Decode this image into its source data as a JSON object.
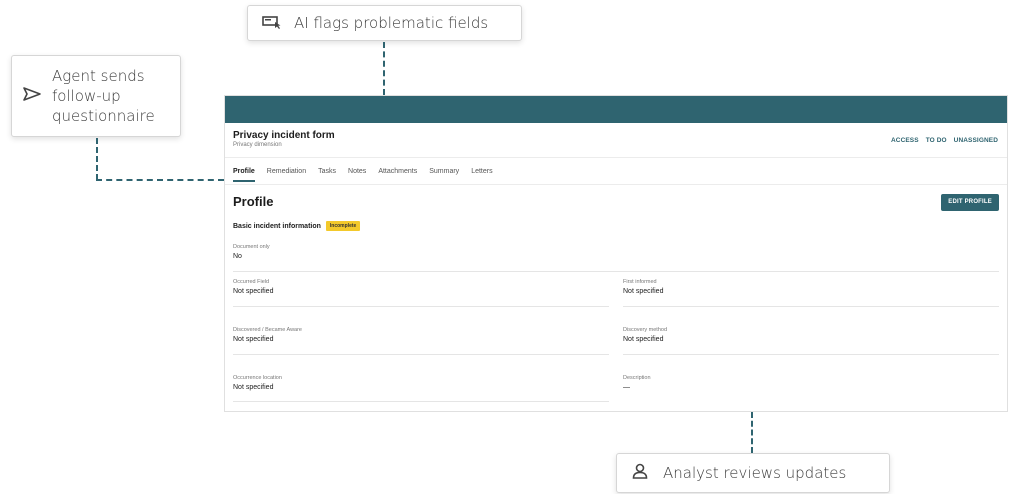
{
  "callouts": {
    "flags": {
      "text": "AI flags problematic fields",
      "icon": "ai-flag-icon"
    },
    "agent": {
      "line1": "Agent sends",
      "line2": "follow-up",
      "line3": "questionnaire",
      "icon": "send-icon"
    },
    "analyst": {
      "text": "Analyst reviews updates",
      "icon": "person-icon"
    }
  },
  "form": {
    "title": "Privacy incident form",
    "subtitle": "Privacy dimension",
    "header_links": [
      "ACCESS",
      "TO DO",
      "UNASSIGNED"
    ],
    "tabs": [
      "Profile",
      "Remediation",
      "Tasks",
      "Notes",
      "Attachments",
      "Summary",
      "Letters"
    ],
    "active_tab": "Profile",
    "page_title": "Profile",
    "edit_button": "EDIT PROFILE",
    "section_label": "Basic incident information",
    "section_badge": "Incomplete",
    "fields": {
      "document_only": {
        "label": "Document only",
        "value": "No"
      },
      "occurred_field": {
        "label": "Occurred Field",
        "value": "Not specified"
      },
      "first_informed": {
        "label": "First informed",
        "value": "Not specified"
      },
      "discovered": {
        "label": "Discovered / Became Aware",
        "value": "Not specified"
      },
      "discovery_method": {
        "label": "Discovery method",
        "value": "Not specified"
      },
      "occurrence_location": {
        "label": "Occurrence location",
        "value": "Not specified"
      },
      "description": {
        "label": "Description",
        "value": "—"
      }
    }
  },
  "colors": {
    "accent": "#2f6470",
    "badge": "#f3c92b"
  }
}
